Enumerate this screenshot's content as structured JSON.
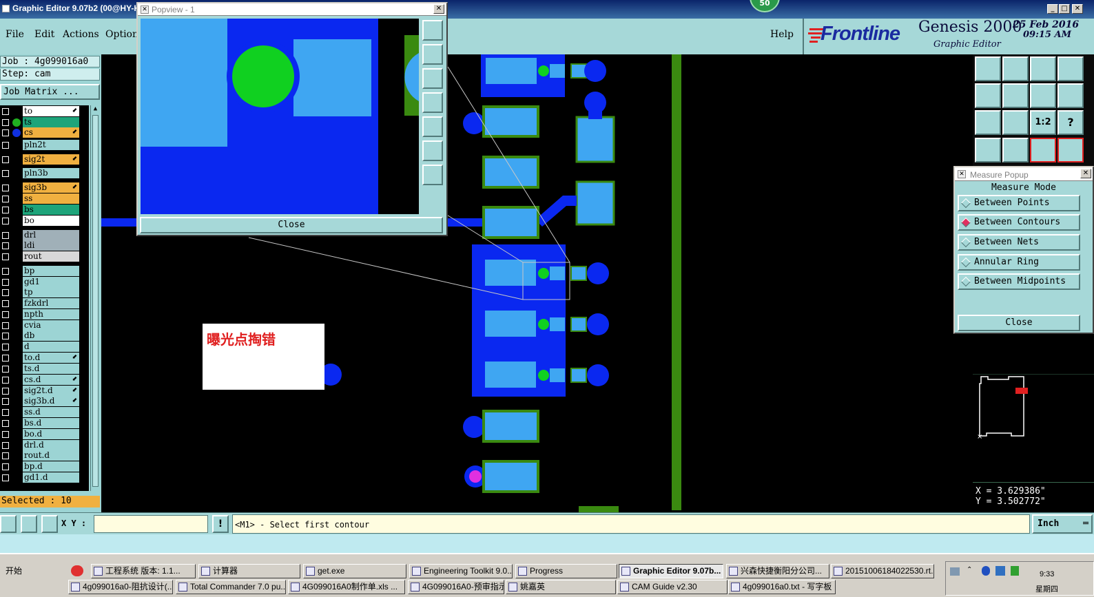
{
  "window": {
    "title": "Graphic Editor 9.07b2 (00@HY-HY",
    "badge": "50"
  },
  "menu": {
    "file": "File",
    "edit": "Edit",
    "actions": "Actions",
    "options": "Option",
    "help": "Help"
  },
  "brand": {
    "logo": "Frontline",
    "product": "Genesis 2000",
    "module": "Graphic Editor",
    "date": "25 Feb 2016",
    "time": "09:15 AM"
  },
  "job": {
    "job_line": "Job : 4g099016a0",
    "step_line": "Step: cam",
    "matrix_button": "Job Matrix ...",
    "selected": "Selected : 10"
  },
  "layers": [
    {
      "name": "to",
      "bg": "#ffffff",
      "dot": "",
      "arrow": true
    },
    {
      "name": "ts",
      "bg": "#1ea47a",
      "dot": "#20b020",
      "arrow": false
    },
    {
      "name": "cs",
      "bg": "#f0b040",
      "dot": "#1030e0",
      "arrow": true
    },
    {
      "name": "pln2t",
      "bg": "#9cd4d4",
      "dot": "",
      "arrow": false
    },
    {
      "name": "sig2t",
      "bg": "#f0b040",
      "dot": "",
      "arrow": true
    },
    {
      "name": "pln3b",
      "bg": "#9cd4d4",
      "dot": "",
      "arrow": false
    },
    {
      "name": "sig3b",
      "bg": "#f0b040",
      "dot": "",
      "arrow": true
    },
    {
      "name": "ss",
      "bg": "#f0b040",
      "dot": "",
      "arrow": false
    },
    {
      "name": "bs",
      "bg": "#1ea47a",
      "dot": "",
      "arrow": false
    },
    {
      "name": "bo",
      "bg": "#ffffff",
      "dot": "",
      "arrow": false
    },
    {
      "name": "drl",
      "bg": "#a0b0b8",
      "dot": "",
      "arrow": false
    },
    {
      "name": "ldi",
      "bg": "#a0b0b8",
      "dot": "",
      "arrow": false
    },
    {
      "name": "rout",
      "bg": "#d8d8d8",
      "dot": "",
      "arrow": false
    },
    {
      "name": "bp",
      "bg": "#9cd4d4",
      "dot": "",
      "arrow": false
    },
    {
      "name": "gd1",
      "bg": "#9cd4d4",
      "dot": "",
      "arrow": false
    },
    {
      "name": "tp",
      "bg": "#9cd4d4",
      "dot": "",
      "arrow": false
    },
    {
      "name": "fzkdrl",
      "bg": "#9cd4d4",
      "dot": "",
      "arrow": false
    },
    {
      "name": "npth",
      "bg": "#9cd4d4",
      "dot": "",
      "arrow": false
    },
    {
      "name": "cvia",
      "bg": "#9cd4d4",
      "dot": "",
      "arrow": false
    },
    {
      "name": "db",
      "bg": "#9cd4d4",
      "dot": "",
      "arrow": false
    },
    {
      "name": "d",
      "bg": "#9cd4d4",
      "dot": "",
      "arrow": false
    },
    {
      "name": "to.d",
      "bg": "#9cd4d4",
      "dot": "",
      "arrow": true
    },
    {
      "name": "ts.d",
      "bg": "#9cd4d4",
      "dot": "",
      "arrow": false
    },
    {
      "name": "cs.d",
      "bg": "#9cd4d4",
      "dot": "",
      "arrow": true
    },
    {
      "name": "sig2t.d",
      "bg": "#9cd4d4",
      "dot": "",
      "arrow": true
    },
    {
      "name": "sig3b.d",
      "bg": "#9cd4d4",
      "dot": "",
      "arrow": true
    },
    {
      "name": "ss.d",
      "bg": "#9cd4d4",
      "dot": "",
      "arrow": false
    },
    {
      "name": "bs.d",
      "bg": "#9cd4d4",
      "dot": "",
      "arrow": false
    },
    {
      "name": "bo.d",
      "bg": "#9cd4d4",
      "dot": "",
      "arrow": false
    },
    {
      "name": "drl.d",
      "bg": "#9cd4d4",
      "dot": "",
      "arrow": false
    },
    {
      "name": "rout.d",
      "bg": "#9cd4d4",
      "dot": "",
      "arrow": false
    },
    {
      "name": "bp.d",
      "bg": "#9cd4d4",
      "dot": "",
      "arrow": false
    },
    {
      "name": "gd1.d",
      "bg": "#9cd4d4",
      "dot": "",
      "arrow": false
    }
  ],
  "popview": {
    "title": "Popview - 1",
    "close": "Close"
  },
  "annotation": {
    "text": "曝光点掏错"
  },
  "measure": {
    "title": "Measure Popup",
    "mode_label": "Measure Mode",
    "options": [
      {
        "label": "Between Points",
        "selected": false
      },
      {
        "label": "Between Contours",
        "selected": true
      },
      {
        "label": "Between Nets",
        "selected": false
      },
      {
        "label": "Annular Ring",
        "selected": false
      },
      {
        "label": "Between Midpoints",
        "selected": false
      }
    ],
    "close": "Close"
  },
  "coords": {
    "x": "X = 3.629386\"",
    "y": "Y = 3.502772\""
  },
  "command": {
    "xy_label": "X Y :",
    "xy_value": "",
    "prompt": "<M1> - Select first contour",
    "units": "Inch"
  },
  "colors": {
    "copper": "#0a28f0",
    "pad": "#3fa6f2",
    "mask": "#3a8a10",
    "drill": "#10d020",
    "magenta": "#e030e0",
    "panel": "#a6d8d8"
  },
  "taskbar": {
    "start": "开始",
    "row1": [
      "工程系统  版本: 1.1...",
      "计算器",
      "get.exe",
      "Engineering Toolkit 9.0...",
      "Progress",
      "Graphic Editor 9.07b...",
      "兴森快捷衡阳分公司...",
      "20151006184022530.rt..."
    ],
    "row2": [
      "4g099016a0-阻抗设计(...",
      "Total Commander 7.0 pu...",
      "4G099016A0制作单.xls ...",
      "4G099016A0-预审指示...",
      "姚嘉英",
      "CAM  Guide v2.30",
      "4g099016a0.txt - 写字板"
    ],
    "clock": "9:33",
    "weekday": "星期四"
  }
}
